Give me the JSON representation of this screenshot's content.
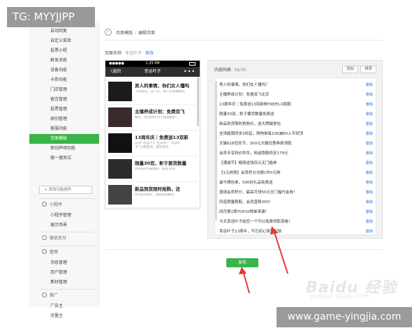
{
  "overlay": {
    "top_left": "TG: MYYJJPP",
    "bottom_right": "www.game-yingjia.com",
    "watermark": "Baidu 经验",
    "watermark_sub": "jingyan.baidu.com"
  },
  "sidebar": {
    "items": [
      {
        "label": "自动回复"
      },
      {
        "label": "自定义菜单"
      },
      {
        "label": "投票小程"
      },
      {
        "label": "群发消息"
      },
      {
        "label": "设备功能"
      },
      {
        "label": "卡券功能"
      },
      {
        "label": "门店管理"
      },
      {
        "label": "留言管理"
      },
      {
        "label": "投票管理"
      },
      {
        "label": "原创管理"
      },
      {
        "label": "客服功能"
      },
      {
        "label": "页面模版"
      },
      {
        "label": "原创声明功能"
      },
      {
        "label": "搜一搜测试"
      }
    ],
    "active_index": 11,
    "add_plugin": "+ 添加功能插件",
    "groups": [
      {
        "title": "小程序",
        "items": [
          "小程序管理",
          "展示场景"
        ]
      },
      {
        "title": "微信支付",
        "items": []
      },
      {
        "title": "管理",
        "items": [
          "消息管理",
          "用户管理",
          "素材管理"
        ]
      },
      {
        "title": "推广",
        "items": [
          "广告主",
          "流量主"
        ]
      }
    ]
  },
  "header": {
    "back_icon": "chevron-left-icon",
    "crumb_parent": "页面模版",
    "crumb_separator": "/",
    "crumb_current": "编辑页面",
    "page_name_label": "页面名称",
    "page_name_value": "幸运叶子",
    "page_name_edit": "修改"
  },
  "phone": {
    "time": "1:25 PM",
    "carrier": "●●●●●",
    "back": "〈返回",
    "title": "幸运叶子",
    "more": "•••",
    "articles": [
      {
        "title": "男人的事情，你们女人懂吗",
        "desc": "不知道说，这一天，男人在家做家务"
      },
      {
        "title": "主播养成计划：免费双飞",
        "desc": "最近，想当网红的人越来越多了"
      },
      {
        "title": "13周年庆｜免费送13双新",
        "desc": "又到“幸运叶子”生日啦！“幸运叶子”13周年庆，即可参与"
      },
      {
        "title": "限量30双，彰于要货数量",
        "desc": "VIP会员专属福利，限量30双"
      },
      {
        "title": "新品到货限时抢购，还",
        "desc": "VIP会员独享，每周新品推荐"
      }
    ]
  },
  "panel": {
    "title": "内容列表",
    "count": "16/30",
    "add_button": "添加",
    "sort_button": "排序",
    "delete_label": "删除",
    "rows": [
      "男人的事情，你们女人懂吗？",
      "主播养成计划：免费双飞北京",
      "13周年庆｜免费送13双新帆FREES.0跑鞋",
      "限量30双，彰于要货数量免费送",
      "新品到货限时抢购价，送大牌健身包",
      "全场超周同多2折起，购物单每100减60上不封顶",
      "天猫618狂欢节，300元大额优惠券疯领取",
      "会员专享特价秒杀，网送跑鞋低至179元",
      "【满减节】精简省钱百元无门槛券",
      "【1元抢购】会员积分兑换1件0元购",
      "最牛晒包单，500份礼品免费送",
      "邀请会员积分，最高可领50元无门槛代金券！",
      "同逛限量跑鞋，会员直降300！",
      "四月第2周TOP10榜单来袭！",
      "今天幸运叶子给您一个可以免费领取资格！",
      "幸运叶子13周年，不忘初心筑梦起航"
    ]
  },
  "footer": {
    "publish_button": "发布"
  },
  "colors": {
    "accent_green": "#3ab449",
    "link_blue": "#2a7be4",
    "annotation_red": "#e53935"
  }
}
